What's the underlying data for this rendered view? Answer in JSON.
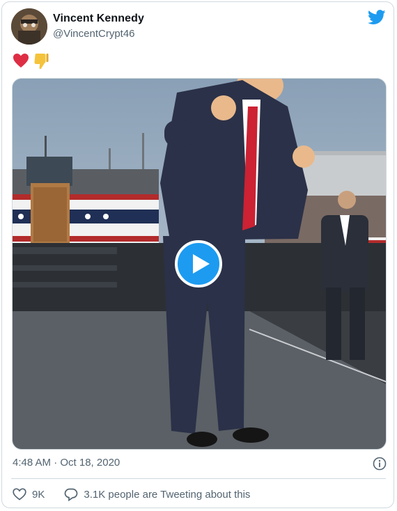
{
  "tweet": {
    "author_name": "Vincent Kennedy",
    "author_handle": "@VincentCrypt46",
    "emojis": [
      "red-heart",
      "thumbs-down"
    ],
    "timestamp": "4:48 AM · Oct 18, 2020",
    "likes": "9K",
    "conversation_text": "3.1K people are Tweeting about this"
  },
  "colors": {
    "twitter_blue": "#1d9bf0",
    "secondary_text": "#536471",
    "heart_red": "#dd2e44",
    "thumb_yellow": "#f5c33b"
  },
  "icons": [
    "twitter-bird-icon",
    "play-icon",
    "info-icon",
    "like-heart-icon",
    "reply-bubble-icon"
  ]
}
